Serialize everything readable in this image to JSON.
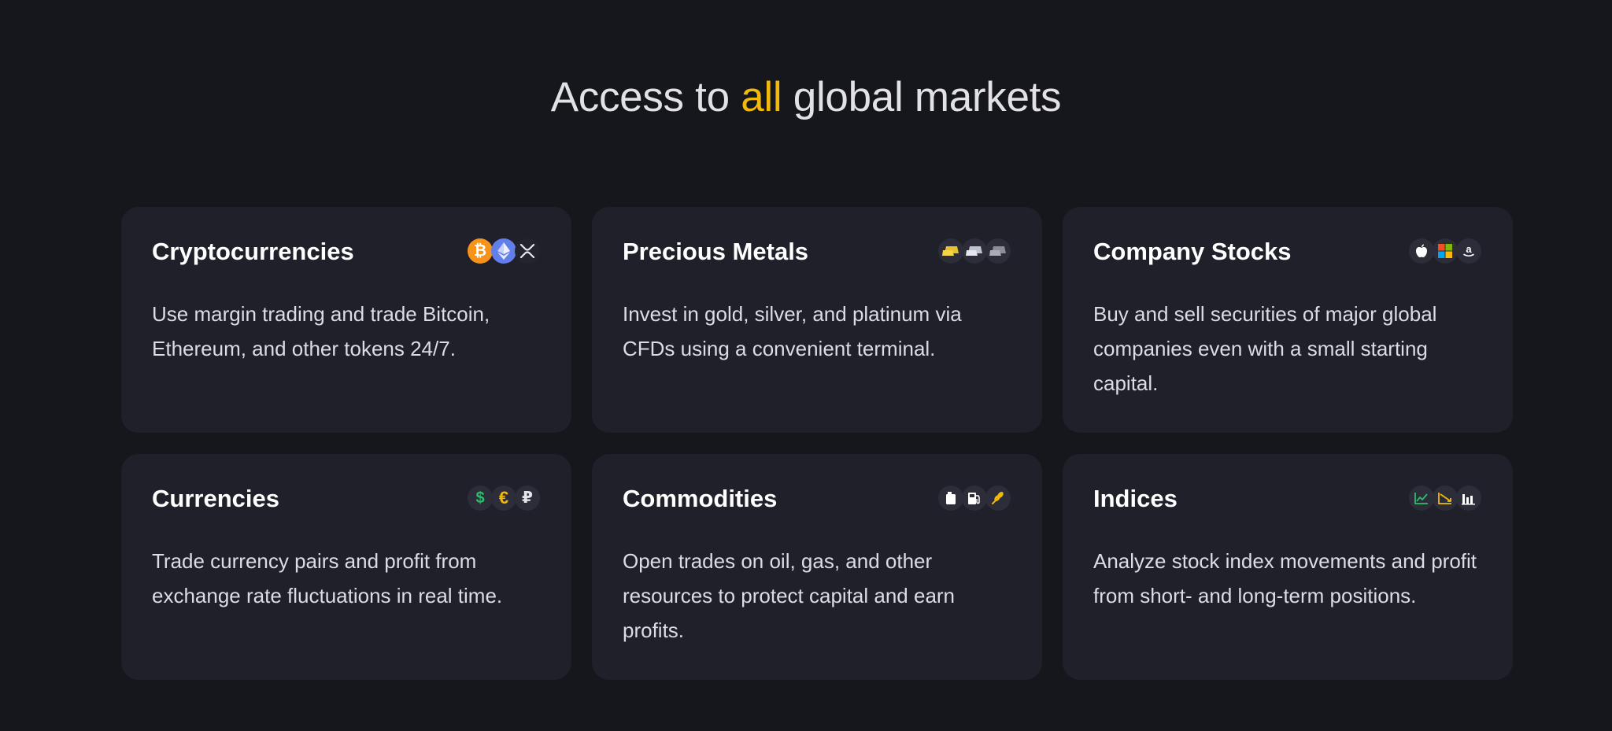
{
  "heading": {
    "prefix": "Access to ",
    "accent": "all",
    "suffix": " global markets",
    "accent_color": "#f0b90b"
  },
  "cards": [
    {
      "title": "Cryptocurrencies",
      "description": "Use margin trading and trade Bitcoin, Ethereum, and other tokens 24/7.",
      "icons": [
        "bitcoin-icon",
        "ethereum-icon",
        "xrp-icon"
      ]
    },
    {
      "title": "Precious Metals",
      "description": "Invest in gold, silver, and platinum via CFDs using a convenient terminal.",
      "icons": [
        "gold-bar-icon",
        "silver-bar-icon",
        "platinum-bar-icon"
      ]
    },
    {
      "title": "Company Stocks",
      "description": "Buy and sell securities of major global companies even with a small starting capital.",
      "icons": [
        "apple-icon",
        "microsoft-icon",
        "amazon-icon"
      ]
    },
    {
      "title": "Currencies",
      "description": "Trade currency pairs and profit from exchange rate fluctuations in real time.",
      "icons": [
        "dollar-icon",
        "euro-icon",
        "ruble-icon"
      ],
      "icon_glyphs": {
        "dollar": "$",
        "euro": "€",
        "ruble": "₽"
      }
    },
    {
      "title": "Commodities",
      "description": "Open trades on oil, gas, and other resources to protect capital and earn profits.",
      "icons": [
        "oil-canister-icon",
        "fuel-pump-icon",
        "wheat-icon"
      ]
    },
    {
      "title": "Indices",
      "description": "Analyze stock index movements and profit from short- and long-term positions.",
      "icons": [
        "line-chart-icon",
        "trend-chart-icon",
        "bar-chart-icon"
      ]
    }
  ],
  "colors": {
    "background": "#16161d",
    "card": "#1f2029",
    "accent": "#f0b90b",
    "bitcoin": "#f7931a",
    "ethereum": "#627eea",
    "green": "#2ebd6b"
  }
}
